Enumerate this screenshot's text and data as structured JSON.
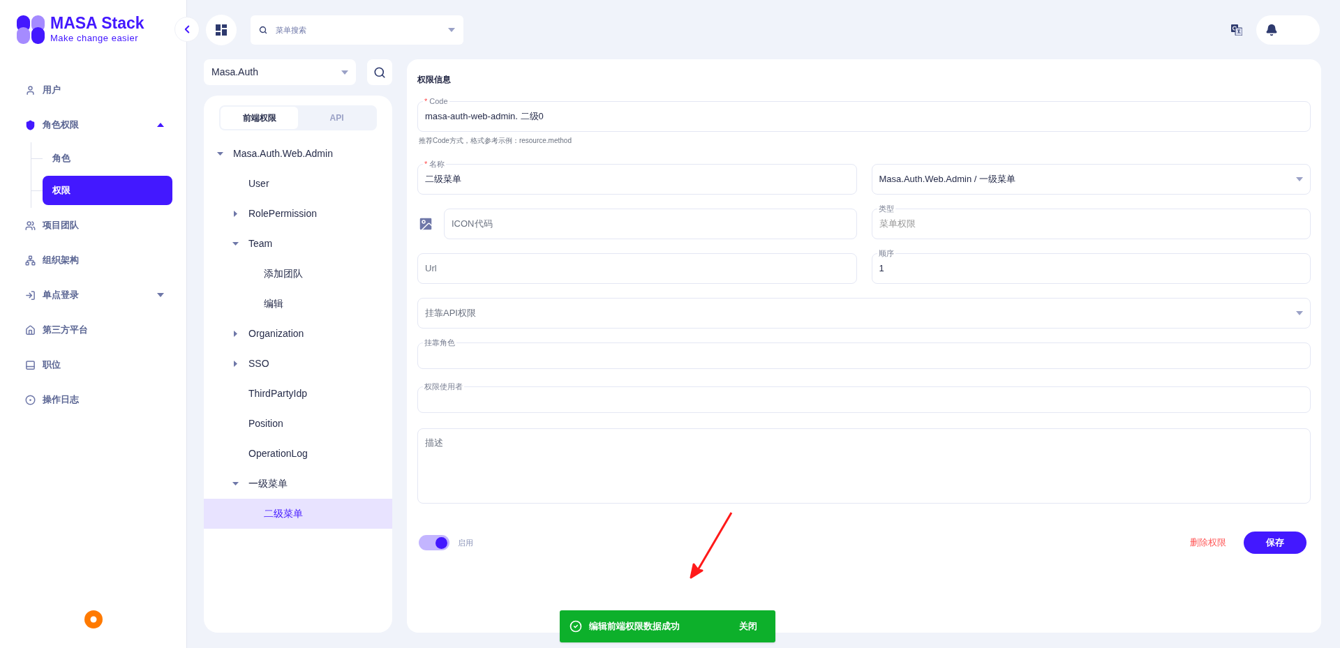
{
  "logo": {
    "title": "MASA Stack",
    "tagline": "Make change easier"
  },
  "sidebar": {
    "items": [
      {
        "label": "用户",
        "selected": false
      },
      {
        "label": "角色权限",
        "selected": false,
        "expanded": true,
        "children": [
          {
            "label": "角色",
            "selected": false
          },
          {
            "label": "权限",
            "selected": true
          }
        ]
      },
      {
        "label": "项目团队",
        "selected": false
      },
      {
        "label": "组织架构",
        "selected": false
      },
      {
        "label": "单点登录",
        "selected": false,
        "expanded": false
      },
      {
        "label": "第三方平台",
        "selected": false
      },
      {
        "label": "职位",
        "selected": false
      },
      {
        "label": "操作日志",
        "selected": false
      }
    ]
  },
  "top_bar": {
    "search": {
      "placeholder": "菜单搜索"
    }
  },
  "tree_panel": {
    "app_select": {
      "value": "Masa.Auth"
    },
    "tabs": [
      {
        "label": "前端权限",
        "selected": true
      },
      {
        "label": "API",
        "selected": false
      }
    ],
    "tree": [
      {
        "label": "Masa.Auth.Web.Admin",
        "selected": false,
        "expanded": true,
        "children": [
          {
            "label": "User",
            "selected": false
          },
          {
            "label": "RolePermission",
            "selected": false,
            "expanded": false
          },
          {
            "label": "Team",
            "selected": false,
            "expanded": true,
            "children": [
              {
                "label": "添加团队",
                "selected": false
              },
              {
                "label": "编辑",
                "selected": false
              }
            ]
          },
          {
            "label": "Organization",
            "selected": false,
            "expanded": false
          },
          {
            "label": "SSO",
            "selected": false,
            "expanded": false
          },
          {
            "label": "ThirdPartyIdp",
            "selected": false
          },
          {
            "label": "Position",
            "selected": false
          },
          {
            "label": "OperationLog",
            "selected": false
          },
          {
            "label": "一级菜单",
            "selected": false,
            "expanded": true,
            "children": [
              {
                "label": "二级菜单",
                "selected": true
              }
            ]
          }
        ]
      }
    ]
  },
  "form": {
    "title": "权限信息",
    "code": {
      "mark": "*",
      "label": "Code",
      "value": "masa-auth-web-admin. 二级0",
      "hint": "推荐Code方式，格式参考示例：resource.method"
    },
    "name": {
      "mark": "*",
      "label": "名称",
      "value": "二级菜单"
    },
    "parent": {
      "value": "Masa.Auth.Web.Admin / 一级菜单"
    },
    "icon": {
      "placeholder": "ICON代码"
    },
    "type": {
      "label": "类型",
      "value": "菜单权限",
      "disabled": true
    },
    "url": {
      "placeholder": "Url"
    },
    "order": {
      "label": "顺序",
      "value": "1"
    },
    "api": {
      "placeholder": "挂靠API权限"
    },
    "roles": {
      "label": "挂靠角色"
    },
    "users": {
      "label": "权限使用者"
    },
    "description": {
      "placeholder": "描述"
    },
    "enabled": {
      "label": "启用",
      "on": true
    },
    "delete_button": "删除权限",
    "save_button": "保存"
  },
  "toast": {
    "message": "编辑前端权限数据成功",
    "action": "关闭"
  }
}
